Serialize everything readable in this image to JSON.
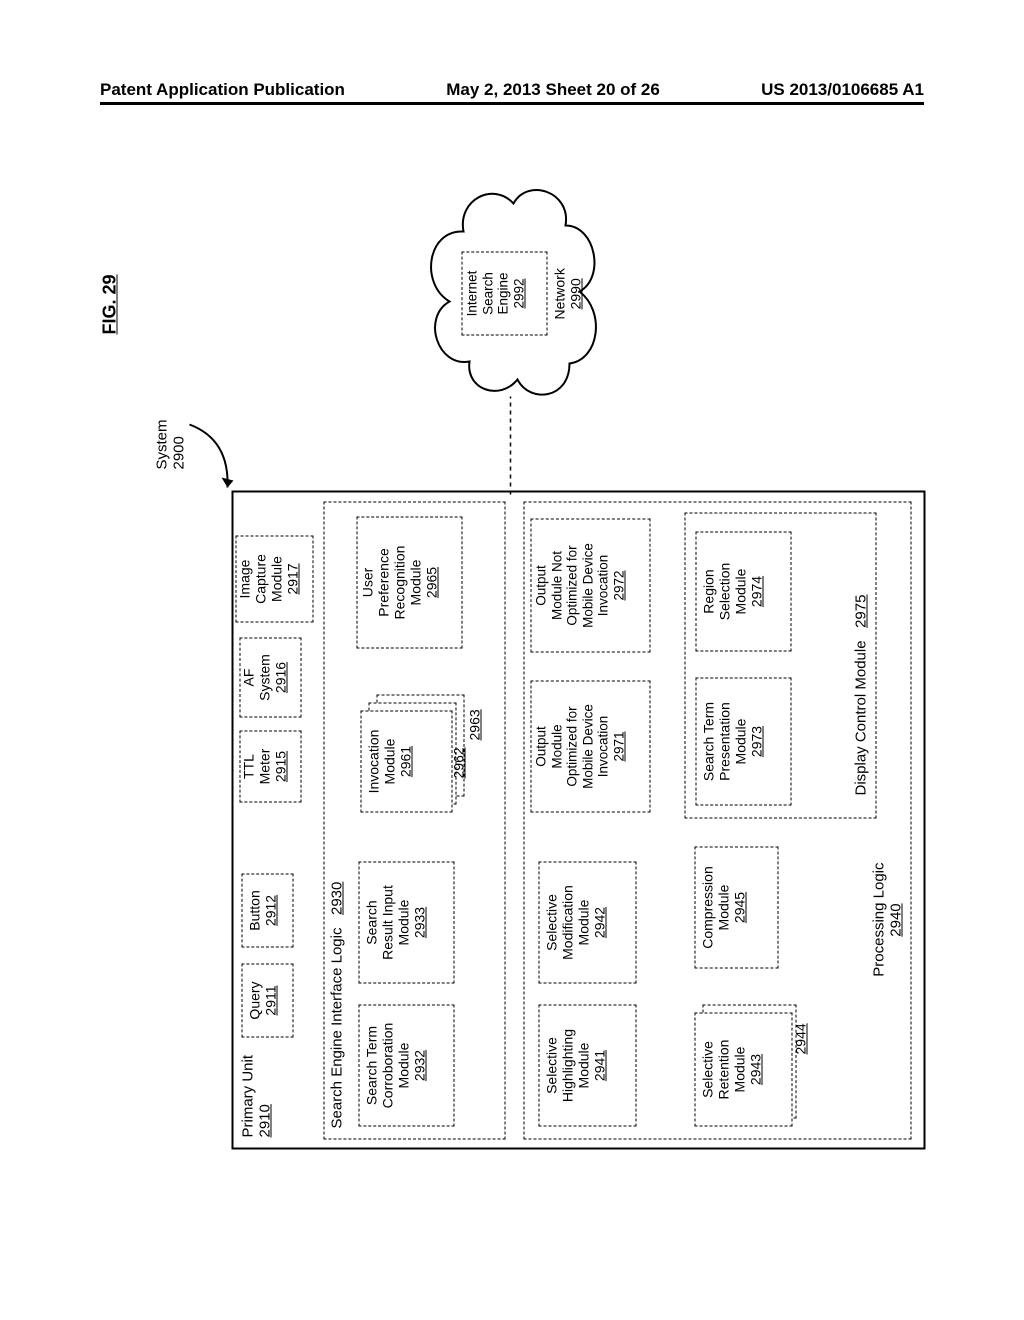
{
  "header": {
    "left": "Patent Application Publication",
    "mid": "May 2, 2013  Sheet 20 of 26",
    "right": "US 2013/0106685 A1"
  },
  "figure": {
    "title": "FIG. 29",
    "system_label": "System",
    "system_ref": "2900"
  },
  "primary_unit": {
    "title": "Primary Unit",
    "ref": "2910"
  },
  "row1": {
    "query": {
      "t": "Query",
      "r": "2911"
    },
    "button": {
      "t": "Button",
      "r": "2912"
    },
    "ttl": {
      "t": "TTL\nMeter",
      "r": "2915"
    },
    "af": {
      "t": "AF\nSystem",
      "r": "2916"
    },
    "img": {
      "t": "Image\nCapture\nModule",
      "r": "2917"
    }
  },
  "sei": {
    "title": "Search Engine Interface Logic",
    "ref": "2930"
  },
  "sei_row": {
    "corroboration": {
      "t": "Search Term\nCorroboration\nModule",
      "r": "2932"
    },
    "result_input": {
      "t": "Search\nResult Input\nModule",
      "r": "2933"
    },
    "invocation": {
      "t": "Invocation\nModule",
      "r": "2961",
      "r2": "2962",
      "r3": "2963"
    },
    "user_pref": {
      "t": "User\nPreference\nRecognition\nModule",
      "r": "2965"
    }
  },
  "processing": {
    "title": "Processing Logic",
    "ref": "2940"
  },
  "proc_top": {
    "highlight": {
      "t": "Selective\nHighlighting\nModule",
      "r": "2941"
    },
    "modification": {
      "t": "Selective\nModification\nModule",
      "r": "2942"
    },
    "opt_mobile": {
      "t": "Output\nModule\nOptimized for\nMobile Device\nInvocation",
      "r": "2971"
    },
    "not_mobile": {
      "t": "Output\nModule Not\nOptimized for\nMobile Device\nInvocation",
      "r": "2972"
    }
  },
  "display_ctrl": {
    "title": "Display Control Module",
    "ref": "2975"
  },
  "proc_bot": {
    "retention": {
      "t": "Selective\nRetention\nModule",
      "r": "2943",
      "r2": "2944"
    },
    "compression": {
      "t": "Compression\nModule",
      "r": "2945"
    },
    "term_present": {
      "t": "Search Term\nPresentation\nModule",
      "r": "2973"
    },
    "region_sel": {
      "t": "Region\nSelection\nModule",
      "r": "2974"
    }
  },
  "network": {
    "label": "Network",
    "ref": "2990",
    "ise": {
      "t": "Internet\nSearch\nEngine",
      "r": "2992"
    }
  }
}
